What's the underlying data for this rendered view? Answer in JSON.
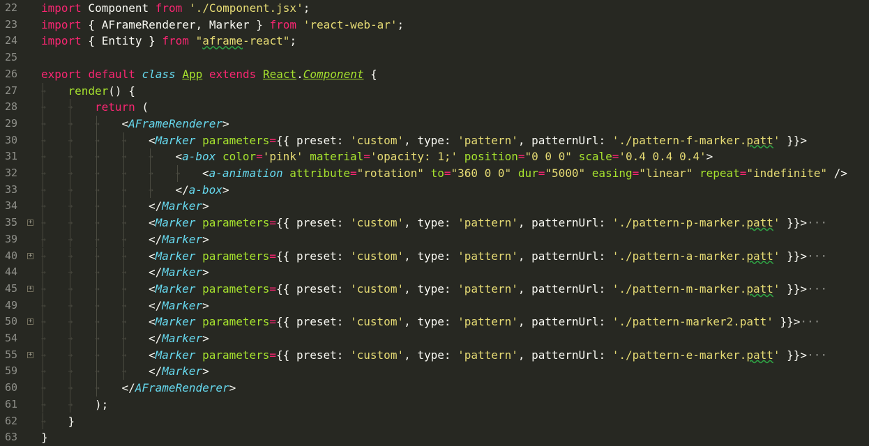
{
  "editor": {
    "theme_colors": {
      "background": "#272822",
      "keyword": "#F92672",
      "string": "#E6DB74",
      "tag": "#66D9EF",
      "attribute": "#A6E22E",
      "text": "#F8F8F2",
      "line_number": "#8F908A"
    },
    "lines": [
      {
        "num": "22",
        "indent": 0,
        "fold": false,
        "tokens": [
          {
            "t": "import",
            "c": "kw"
          },
          {
            "t": " Component ",
            "c": "punc"
          },
          {
            "t": "from",
            "c": "kw"
          },
          {
            "t": " ",
            "c": "punc"
          },
          {
            "t": "'./Component.jsx'",
            "c": "str"
          },
          {
            "t": ";",
            "c": "punc"
          }
        ]
      },
      {
        "num": "23",
        "indent": 0,
        "fold": false,
        "tokens": [
          {
            "t": "import",
            "c": "kw"
          },
          {
            "t": " { AFrameRenderer, Marker } ",
            "c": "punc"
          },
          {
            "t": "from",
            "c": "kw"
          },
          {
            "t": " ",
            "c": "punc"
          },
          {
            "t": "'react-web-ar'",
            "c": "str"
          },
          {
            "t": ";",
            "c": "punc"
          }
        ]
      },
      {
        "num": "24",
        "indent": 0,
        "fold": false,
        "tokens": [
          {
            "t": "import",
            "c": "kw"
          },
          {
            "t": " { Entity } ",
            "c": "punc"
          },
          {
            "t": "from",
            "c": "kw"
          },
          {
            "t": " ",
            "c": "punc"
          },
          {
            "t": "\"",
            "c": "str"
          },
          {
            "t": "aframe",
            "c": "str squig"
          },
          {
            "t": "-react\"",
            "c": "str"
          },
          {
            "t": ";",
            "c": "punc"
          }
        ]
      },
      {
        "num": "25",
        "indent": 0,
        "fold": false,
        "tokens": []
      },
      {
        "num": "26",
        "indent": 0,
        "fold": false,
        "tokens": [
          {
            "t": "export",
            "c": "kw"
          },
          {
            "t": " ",
            "c": "punc"
          },
          {
            "t": "default",
            "c": "kw"
          },
          {
            "t": " ",
            "c": "punc"
          },
          {
            "t": "class",
            "c": "cls"
          },
          {
            "t": " ",
            "c": "punc"
          },
          {
            "t": "App",
            "c": "ent"
          },
          {
            "t": " ",
            "c": "punc"
          },
          {
            "t": "extends",
            "c": "kw"
          },
          {
            "t": " ",
            "c": "punc"
          },
          {
            "t": "React",
            "c": "ent"
          },
          {
            "t": ".",
            "c": "punc"
          },
          {
            "t": "Component",
            "c": "ent-it"
          },
          {
            "t": " {",
            "c": "punc"
          }
        ]
      },
      {
        "num": "27",
        "indent": 1,
        "fold": false,
        "tokens": [
          {
            "t": "render",
            "c": "fn"
          },
          {
            "t": "() {",
            "c": "punc"
          }
        ]
      },
      {
        "num": "28",
        "indent": 2,
        "fold": false,
        "tokens": [
          {
            "t": "return",
            "c": "kw"
          },
          {
            "t": " (",
            "c": "punc"
          }
        ]
      },
      {
        "num": "29",
        "indent": 3,
        "fold": false,
        "tokens": [
          {
            "t": "<",
            "c": "punc"
          },
          {
            "t": "AFrameRenderer",
            "c": "tag"
          },
          {
            "t": ">",
            "c": "punc"
          }
        ]
      },
      {
        "num": "30",
        "indent": 4,
        "fold": false,
        "tokens": [
          {
            "t": "<",
            "c": "punc"
          },
          {
            "t": "Marker",
            "c": "tag"
          },
          {
            "t": " ",
            "c": "punc"
          },
          {
            "t": "parameters",
            "c": "attr"
          },
          {
            "t": "=",
            "c": "kw"
          },
          {
            "t": "{{ preset: ",
            "c": "punc"
          },
          {
            "t": "'custom'",
            "c": "str"
          },
          {
            "t": ", type: ",
            "c": "punc"
          },
          {
            "t": "'pattern'",
            "c": "str"
          },
          {
            "t": ", patternUrl: ",
            "c": "punc"
          },
          {
            "t": "'./pattern-f-marker.",
            "c": "str"
          },
          {
            "t": "patt",
            "c": "str squig"
          },
          {
            "t": "'",
            "c": "str"
          },
          {
            "t": " }}>",
            "c": "punc"
          }
        ]
      },
      {
        "num": "31",
        "indent": 5,
        "fold": false,
        "tokens": [
          {
            "t": "<",
            "c": "punc"
          },
          {
            "t": "a-box",
            "c": "tag"
          },
          {
            "t": " ",
            "c": "punc"
          },
          {
            "t": "color",
            "c": "attr"
          },
          {
            "t": "=",
            "c": "kw"
          },
          {
            "t": "'pink'",
            "c": "str"
          },
          {
            "t": " ",
            "c": "punc"
          },
          {
            "t": "material",
            "c": "attr"
          },
          {
            "t": "=",
            "c": "kw"
          },
          {
            "t": "'opacity: 1;'",
            "c": "str"
          },
          {
            "t": " ",
            "c": "punc"
          },
          {
            "t": "position",
            "c": "attr"
          },
          {
            "t": "=",
            "c": "kw"
          },
          {
            "t": "\"0 0 0\"",
            "c": "str"
          },
          {
            "t": " ",
            "c": "punc"
          },
          {
            "t": "scale",
            "c": "attr"
          },
          {
            "t": "=",
            "c": "kw"
          },
          {
            "t": "'0.4 0.4 0.4'",
            "c": "str"
          },
          {
            "t": ">",
            "c": "punc"
          }
        ]
      },
      {
        "num": "32",
        "indent": 6,
        "fold": false,
        "tokens": [
          {
            "t": "<",
            "c": "punc"
          },
          {
            "t": "a-animation",
            "c": "tag"
          },
          {
            "t": " ",
            "c": "punc"
          },
          {
            "t": "attribute",
            "c": "attr"
          },
          {
            "t": "=",
            "c": "kw"
          },
          {
            "t": "\"rotation\"",
            "c": "str"
          },
          {
            "t": " ",
            "c": "punc"
          },
          {
            "t": "to",
            "c": "attr"
          },
          {
            "t": "=",
            "c": "kw"
          },
          {
            "t": "\"360 0 0\"",
            "c": "str"
          },
          {
            "t": " ",
            "c": "punc"
          },
          {
            "t": "dur",
            "c": "attr"
          },
          {
            "t": "=",
            "c": "kw"
          },
          {
            "t": "\"5000\"",
            "c": "str"
          },
          {
            "t": " ",
            "c": "punc"
          },
          {
            "t": "easing",
            "c": "attr"
          },
          {
            "t": "=",
            "c": "kw"
          },
          {
            "t": "\"linear\"",
            "c": "str"
          },
          {
            "t": " ",
            "c": "punc"
          },
          {
            "t": "repeat",
            "c": "attr"
          },
          {
            "t": "=",
            "c": "kw"
          },
          {
            "t": "\"indefinite\"",
            "c": "str"
          },
          {
            "t": " />",
            "c": "punc"
          }
        ]
      },
      {
        "num": "33",
        "indent": 5,
        "fold": false,
        "tokens": [
          {
            "t": "</",
            "c": "punc"
          },
          {
            "t": "a-box",
            "c": "tag"
          },
          {
            "t": ">",
            "c": "punc"
          }
        ]
      },
      {
        "num": "34",
        "indent": 4,
        "fold": false,
        "tokens": [
          {
            "t": "</",
            "c": "punc"
          },
          {
            "t": "Marker",
            "c": "tag"
          },
          {
            "t": ">",
            "c": "punc"
          }
        ]
      },
      {
        "num": "35",
        "indent": 4,
        "fold": true,
        "tokens": [
          {
            "t": "<",
            "c": "punc"
          },
          {
            "t": "Marker",
            "c": "tag"
          },
          {
            "t": " ",
            "c": "punc"
          },
          {
            "t": "parameters",
            "c": "attr"
          },
          {
            "t": "=",
            "c": "kw"
          },
          {
            "t": "{{ preset: ",
            "c": "punc"
          },
          {
            "t": "'custom'",
            "c": "str"
          },
          {
            "t": ", type: ",
            "c": "punc"
          },
          {
            "t": "'pattern'",
            "c": "str"
          },
          {
            "t": ", patternUrl: ",
            "c": "punc"
          },
          {
            "t": "'./pattern-p-marker.",
            "c": "str"
          },
          {
            "t": "patt",
            "c": "str squig"
          },
          {
            "t": "'",
            "c": "str"
          },
          {
            "t": " }}>",
            "c": "punc"
          },
          {
            "t": "···",
            "c": "ell"
          }
        ]
      },
      {
        "num": "39",
        "indent": 4,
        "fold": false,
        "tokens": [
          {
            "t": "</",
            "c": "punc"
          },
          {
            "t": "Marker",
            "c": "tag"
          },
          {
            "t": ">",
            "c": "punc"
          }
        ]
      },
      {
        "num": "40",
        "indent": 4,
        "fold": true,
        "tokens": [
          {
            "t": "<",
            "c": "punc"
          },
          {
            "t": "Marker",
            "c": "tag"
          },
          {
            "t": " ",
            "c": "punc"
          },
          {
            "t": "parameters",
            "c": "attr"
          },
          {
            "t": "=",
            "c": "kw"
          },
          {
            "t": "{{ preset: ",
            "c": "punc"
          },
          {
            "t": "'custom'",
            "c": "str"
          },
          {
            "t": ", type: ",
            "c": "punc"
          },
          {
            "t": "'pattern'",
            "c": "str"
          },
          {
            "t": ", patternUrl: ",
            "c": "punc"
          },
          {
            "t": "'./pattern-a-marker.",
            "c": "str"
          },
          {
            "t": "patt",
            "c": "str squig"
          },
          {
            "t": "'",
            "c": "str"
          },
          {
            "t": " }}>",
            "c": "punc"
          },
          {
            "t": "···",
            "c": "ell"
          }
        ]
      },
      {
        "num": "44",
        "indent": 4,
        "fold": false,
        "tokens": [
          {
            "t": "</",
            "c": "punc"
          },
          {
            "t": "Marker",
            "c": "tag"
          },
          {
            "t": ">",
            "c": "punc"
          }
        ]
      },
      {
        "num": "45",
        "indent": 4,
        "fold": true,
        "tokens": [
          {
            "t": "<",
            "c": "punc"
          },
          {
            "t": "Marker",
            "c": "tag"
          },
          {
            "t": " ",
            "c": "punc"
          },
          {
            "t": "parameters",
            "c": "attr"
          },
          {
            "t": "=",
            "c": "kw"
          },
          {
            "t": "{{ preset: ",
            "c": "punc"
          },
          {
            "t": "'custom'",
            "c": "str"
          },
          {
            "t": ", type: ",
            "c": "punc"
          },
          {
            "t": "'pattern'",
            "c": "str"
          },
          {
            "t": ", patternUrl: ",
            "c": "punc"
          },
          {
            "t": "'./pattern-m-marker.",
            "c": "str"
          },
          {
            "t": "patt",
            "c": "str squig"
          },
          {
            "t": "'",
            "c": "str"
          },
          {
            "t": " }}>",
            "c": "punc"
          },
          {
            "t": "···",
            "c": "ell"
          }
        ]
      },
      {
        "num": "49",
        "indent": 4,
        "fold": false,
        "tokens": [
          {
            "t": "</",
            "c": "punc"
          },
          {
            "t": "Marker",
            "c": "tag"
          },
          {
            "t": ">",
            "c": "punc"
          }
        ]
      },
      {
        "num": "50",
        "indent": 4,
        "fold": true,
        "tokens": [
          {
            "t": "<",
            "c": "punc"
          },
          {
            "t": "Marker",
            "c": "tag"
          },
          {
            "t": " ",
            "c": "punc"
          },
          {
            "t": "parameters",
            "c": "attr"
          },
          {
            "t": "=",
            "c": "kw"
          },
          {
            "t": "{{ preset: ",
            "c": "punc"
          },
          {
            "t": "'custom'",
            "c": "str"
          },
          {
            "t": ", type: ",
            "c": "punc"
          },
          {
            "t": "'pattern'",
            "c": "str"
          },
          {
            "t": ", patternUrl: ",
            "c": "punc"
          },
          {
            "t": "'./pattern-marker2.patt'",
            "c": "str"
          },
          {
            "t": " }}>",
            "c": "punc"
          },
          {
            "t": "···",
            "c": "ell"
          }
        ]
      },
      {
        "num": "54",
        "indent": 4,
        "fold": false,
        "tokens": [
          {
            "t": "</",
            "c": "punc"
          },
          {
            "t": "Marker",
            "c": "tag"
          },
          {
            "t": ">",
            "c": "punc"
          }
        ]
      },
      {
        "num": "55",
        "indent": 4,
        "fold": true,
        "tokens": [
          {
            "t": "<",
            "c": "punc"
          },
          {
            "t": "Marker",
            "c": "tag"
          },
          {
            "t": " ",
            "c": "punc"
          },
          {
            "t": "parameters",
            "c": "attr"
          },
          {
            "t": "=",
            "c": "kw"
          },
          {
            "t": "{{ preset: ",
            "c": "punc"
          },
          {
            "t": "'custom'",
            "c": "str"
          },
          {
            "t": ", type: ",
            "c": "punc"
          },
          {
            "t": "'pattern'",
            "c": "str"
          },
          {
            "t": ", patternUrl: ",
            "c": "punc"
          },
          {
            "t": "'./pattern-e-marker.",
            "c": "str"
          },
          {
            "t": "patt",
            "c": "str squig"
          },
          {
            "t": "'",
            "c": "str"
          },
          {
            "t": " }}>",
            "c": "punc"
          },
          {
            "t": "···",
            "c": "ell"
          }
        ]
      },
      {
        "num": "59",
        "indent": 4,
        "fold": false,
        "tokens": [
          {
            "t": "</",
            "c": "punc"
          },
          {
            "t": "Marker",
            "c": "tag"
          },
          {
            "t": ">",
            "c": "punc"
          }
        ]
      },
      {
        "num": "60",
        "indent": 3,
        "fold": false,
        "tokens": [
          {
            "t": "</",
            "c": "punc"
          },
          {
            "t": "AFrameRenderer",
            "c": "tag"
          },
          {
            "t": ">",
            "c": "punc"
          }
        ]
      },
      {
        "num": "61",
        "indent": 2,
        "fold": false,
        "tokens": [
          {
            "t": ");",
            "c": "punc"
          }
        ]
      },
      {
        "num": "62",
        "indent": 1,
        "fold": false,
        "tokens": [
          {
            "t": "}",
            "c": "punc"
          }
        ]
      },
      {
        "num": "63",
        "indent": 0,
        "fold": false,
        "tokens": [
          {
            "t": "}",
            "c": "punc"
          }
        ]
      }
    ]
  }
}
